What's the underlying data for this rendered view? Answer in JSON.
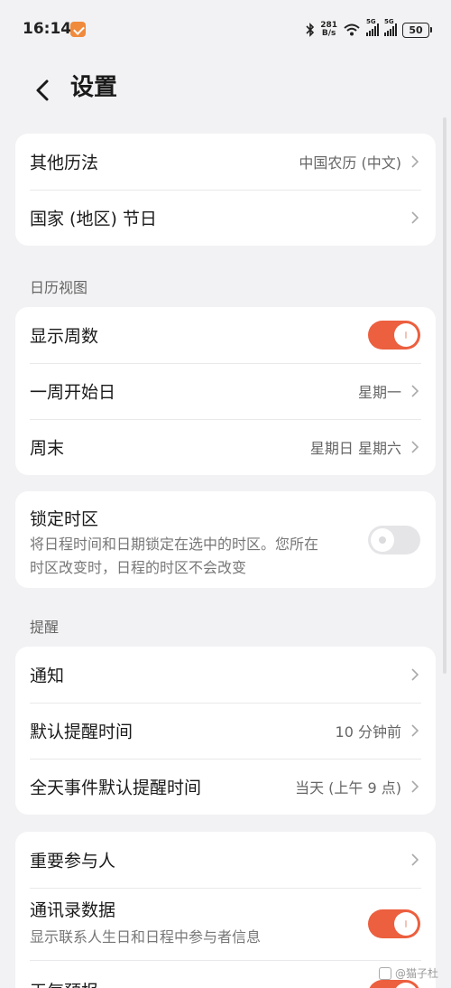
{
  "status_bar": {
    "time": "16:14",
    "net_speed_value": "281",
    "net_speed_unit": "B/s",
    "signal_1_label": "5G",
    "signal_2_label": "5G",
    "battery": "50"
  },
  "header": {
    "title": "设置"
  },
  "group_top": {
    "other_calendar_label": "其他历法",
    "other_calendar_value": "中国农历 (中文)",
    "holidays_label": "国家 (地区) 节日"
  },
  "calendar_view": {
    "section_title": "日历视图",
    "show_week_numbers_label": "显示周数",
    "show_week_numbers_on": true,
    "week_start_label": "一周开始日",
    "week_start_value": "星期一",
    "weekend_label": "周末",
    "weekend_value": "星期日 星期六"
  },
  "timezone": {
    "label": "锁定时区",
    "description": "将日程时间和日期锁定在选中的时区。您所在时区改变时，日程的时区不会改变",
    "enabled": false
  },
  "reminders": {
    "section_title": "提醒",
    "notifications_label": "通知",
    "default_reminder_label": "默认提醒时间",
    "default_reminder_value": "10 分钟前",
    "allday_reminder_label": "全天事件默认提醒时间",
    "allday_reminder_value": "当天 (上午 9 点)"
  },
  "more": {
    "vip_label": "重要参与人",
    "contacts_label": "通讯录数据",
    "contacts_description": "显示联系人生日和日程中参与者信息",
    "contacts_enabled": true,
    "weather_label": "天气预报",
    "weather_enabled": true
  },
  "watermark": "@猫子杜",
  "colors": {
    "accent": "#ec5f3f",
    "background": "#f2f2f4",
    "card": "#ffffff"
  }
}
